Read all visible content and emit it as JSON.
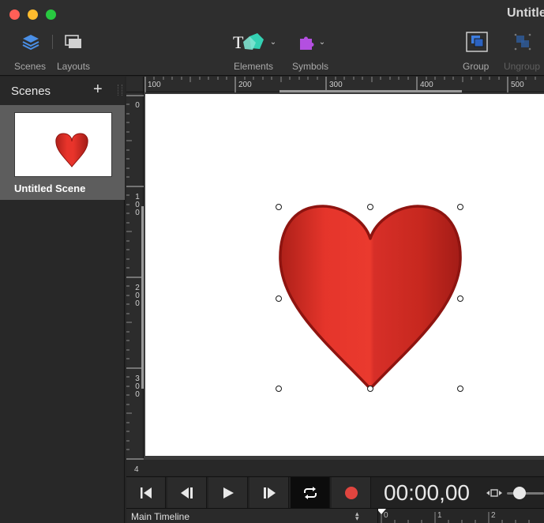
{
  "window": {
    "title": "Untitled"
  },
  "toolbar": {
    "scenes_label": "Scenes",
    "layouts_label": "Layouts",
    "elements_label": "Elements",
    "symbols_label": "Symbols",
    "group_label": "Group",
    "ungroup_label": "Ungroup"
  },
  "sidebar": {
    "title": "Scenes",
    "scenes": [
      {
        "name": "Untitled Scene"
      }
    ]
  },
  "ruler": {
    "top_labels": [
      "100",
      "200",
      "300",
      "400",
      "500"
    ],
    "left_labels": [
      "0",
      "1\n0\n0",
      "2\n0\n0",
      "3\n0\n0"
    ],
    "bottom_label": "4"
  },
  "transport": {
    "time": "00:00,00"
  },
  "timeline": {
    "selected": "Main Timeline",
    "ticks": [
      "0",
      "1",
      "2"
    ]
  },
  "colors": {
    "heart_fill": "#e8342b",
    "heart_stroke": "#8e1410",
    "record": "#e0453f",
    "accent": "#4a8fe6"
  }
}
